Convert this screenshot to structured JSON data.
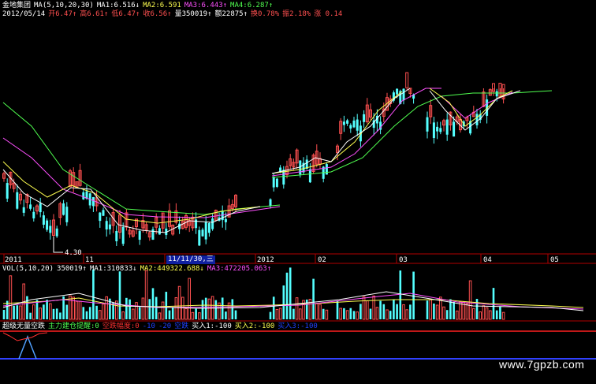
{
  "header": {
    "stock_name": "金地集团",
    "ma_label": "MA(5,10,20,30)",
    "ma1": "MA1:6.516↓",
    "ma2": "MA2:6.591",
    "ma3": "MA3:6.443↑",
    "ma4": "MA4:6.287↑",
    "date": "2012/05/14",
    "open": "开6.47↑",
    "high": "高6.61↑",
    "low": "低6.47↑",
    "close": "收6.56↑",
    "volume": "量350019↑",
    "amount": "额22875↑",
    "turnover": "换0.78%",
    "amplitude": "振2.18%",
    "change": "涨 0.14"
  },
  "price_chart": {
    "low_marker": "4.30"
  },
  "time_axis": {
    "labels": [
      "2011",
      "11",
      "2012",
      "02",
      "03",
      "04",
      "05"
    ],
    "cursor_label": "11/11/30,三"
  },
  "volume_panel": {
    "label": "VOL(5,10,20)",
    "value": "350019↑",
    "ma1": "MA1:310833↓",
    "ma2": "MA2:449322.688↓",
    "ma3": "MA3:472205.063↑"
  },
  "indicator_panel": {
    "name": "超级无量空跌",
    "item1": "主力建仓提醒:0",
    "item2": "空跌幅度:0",
    "item3": "-10",
    "item4": "-20",
    "item5": "空跌",
    "item6": "买入1:-100",
    "item7": "买入2:-100",
    "item8": "买入3:-100"
  },
  "watermark": "www.7gpzb.com",
  "colors": {
    "up": "#ff5050",
    "down": "#54ffff",
    "ma1": "#ffffff",
    "ma2": "#ffff50",
    "ma3": "#ff50ff",
    "ma4": "#50ff50"
  }
}
